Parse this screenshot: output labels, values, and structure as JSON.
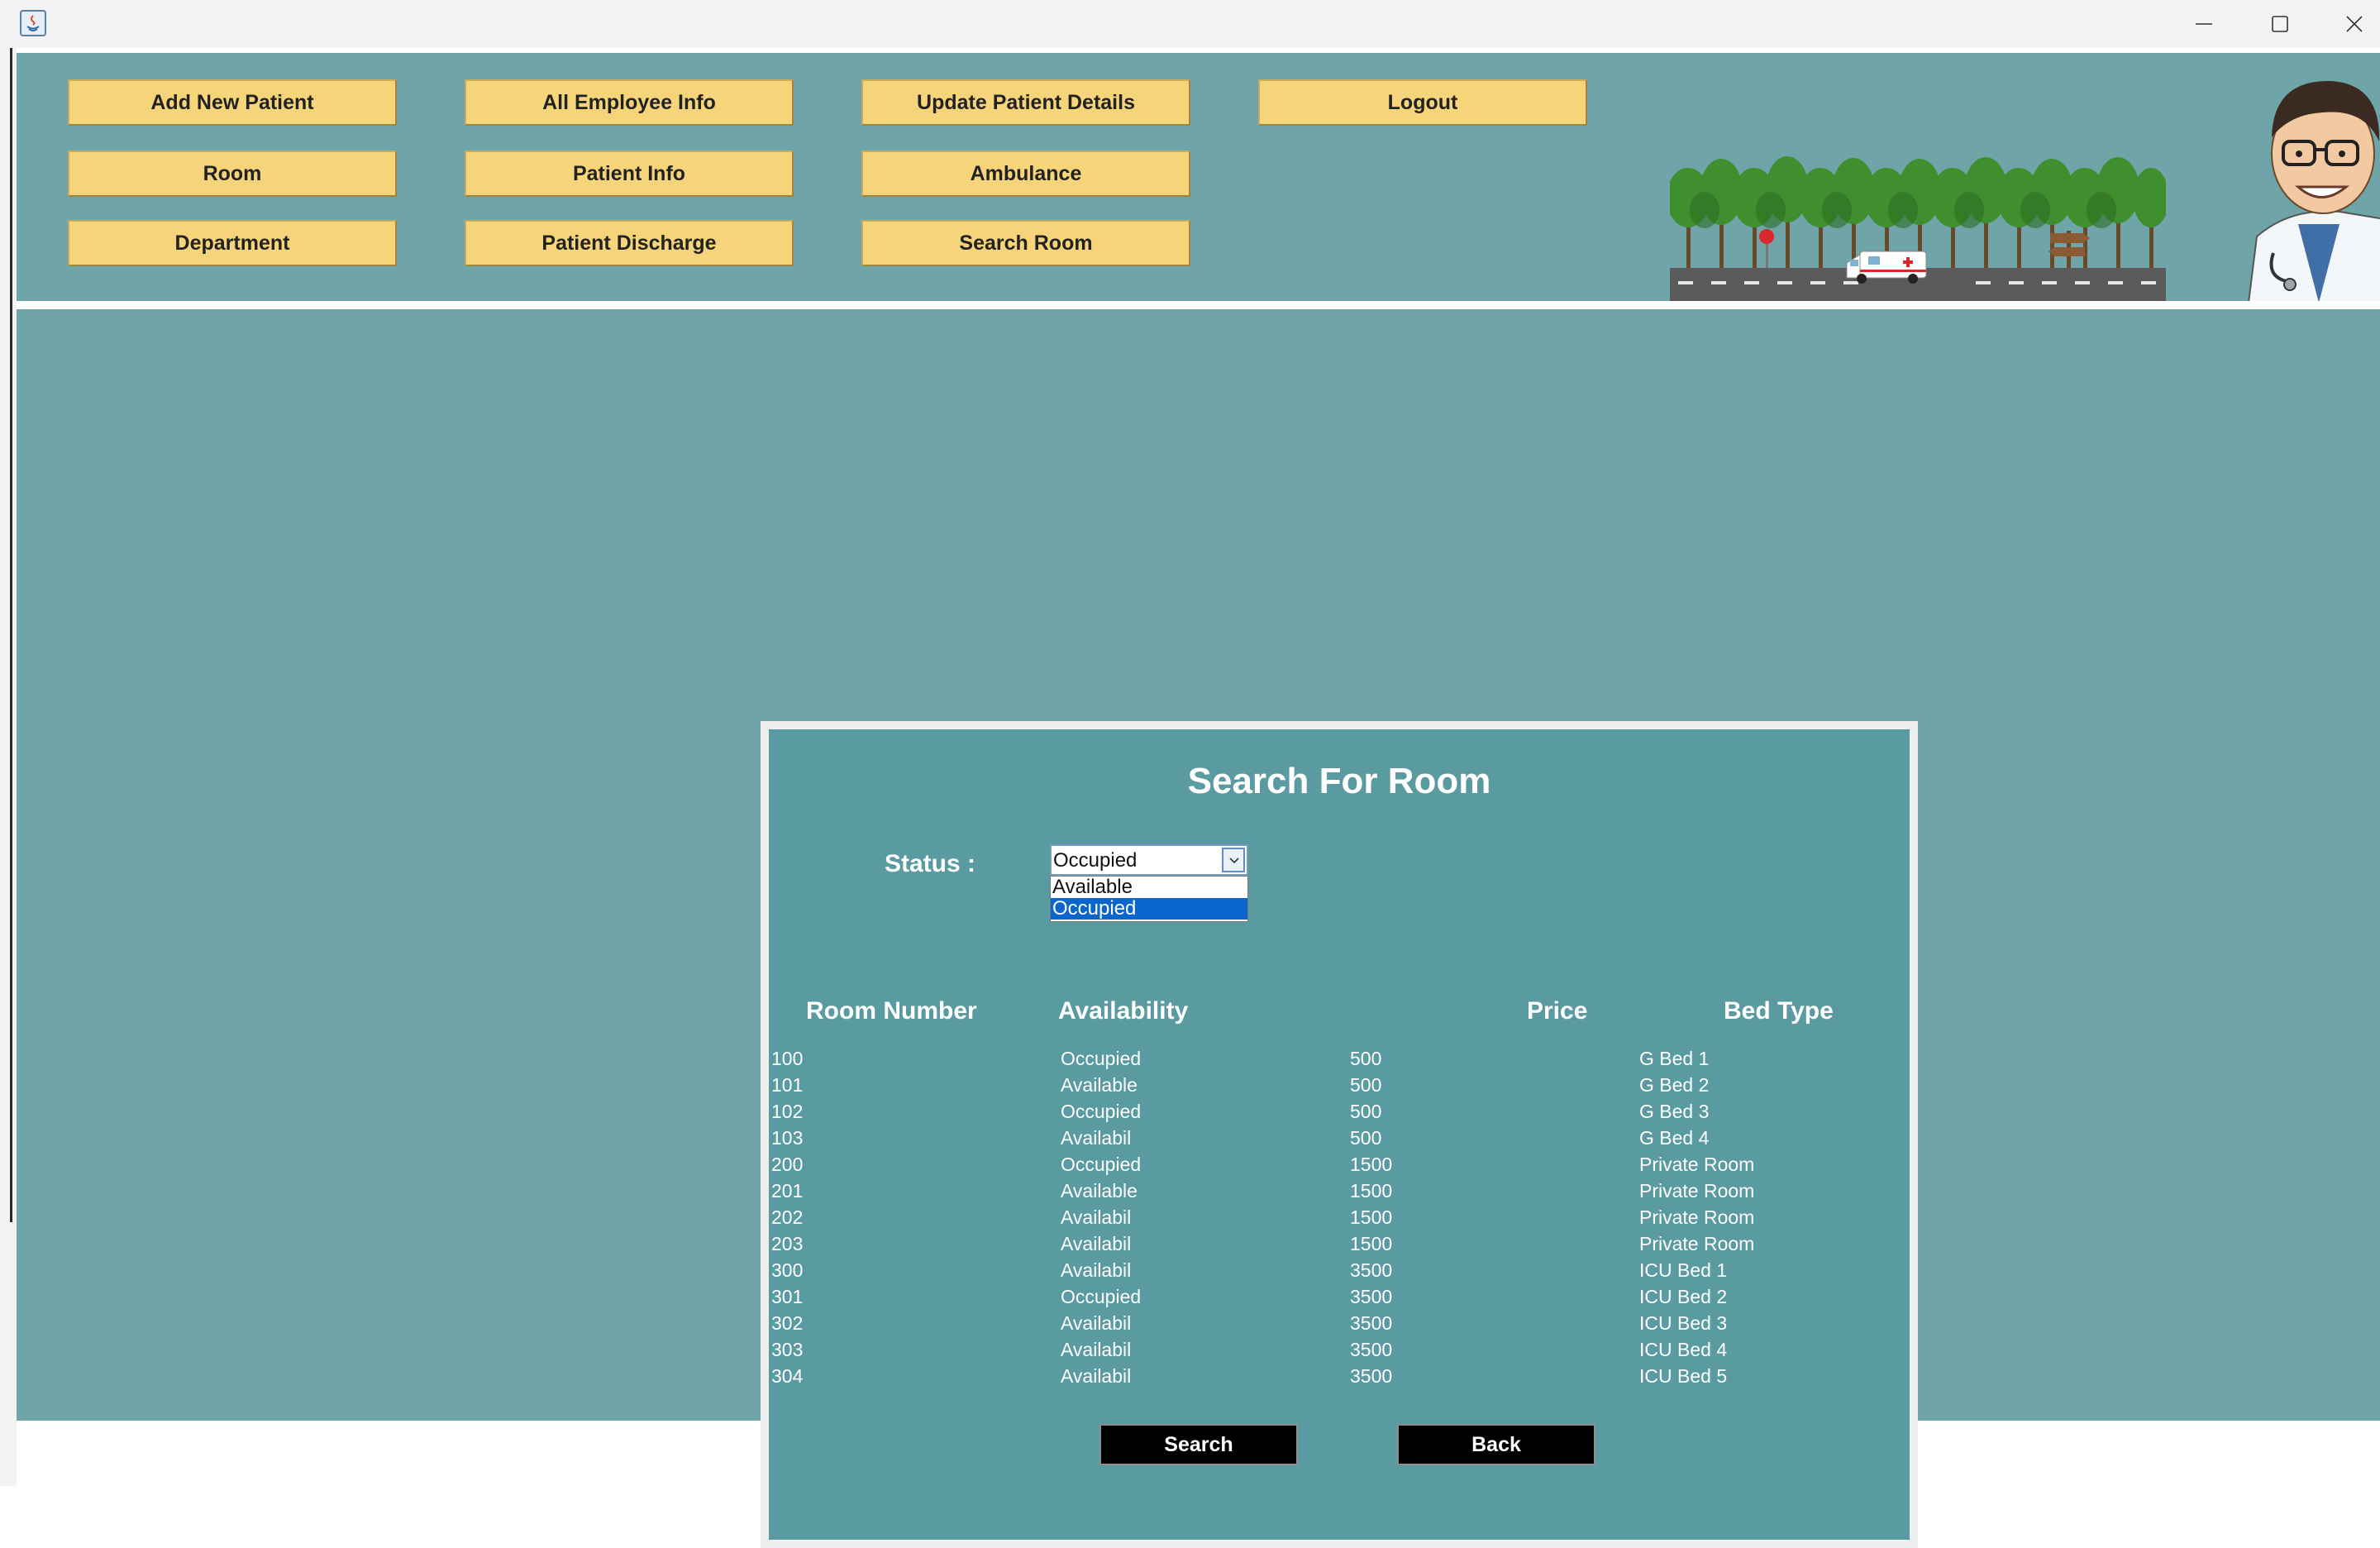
{
  "window": {
    "app_icon": "java-icon",
    "controls": [
      "minimize-icon",
      "maximize-icon",
      "close-icon"
    ]
  },
  "nav": {
    "buttons": [
      {
        "label": "Add New Patient"
      },
      {
        "label": "All Employee Info"
      },
      {
        "label": "Update Patient Details"
      },
      {
        "label": "Logout"
      },
      {
        "label": "Room"
      },
      {
        "label": "Patient Info"
      },
      {
        "label": "Ambulance"
      },
      {
        "label": "Department"
      },
      {
        "label": "Patient Discharge"
      },
      {
        "label": "Search Room"
      }
    ]
  },
  "search_room": {
    "title": "Search For Room",
    "status_label": "Status :",
    "status_selected": "Occupied",
    "status_options": [
      "Available",
      "Occupied"
    ],
    "highlighted_option": "Occupied",
    "columns": [
      "Room Number",
      "Availability",
      "Price",
      "Bed Type"
    ],
    "rows": [
      [
        "100",
        "Occupied",
        "500",
        "G Bed 1"
      ],
      [
        "101",
        "Available",
        "500",
        "G Bed 2"
      ],
      [
        "102",
        "Occupied",
        "500",
        "G Bed 3"
      ],
      [
        "103",
        "Availabil",
        "500",
        "G Bed 4"
      ],
      [
        "200",
        "Occupied",
        "1500",
        "Private Room"
      ],
      [
        "201",
        "Available",
        "1500",
        "Private Room"
      ],
      [
        "202",
        "Availabil",
        "1500",
        "Private Room"
      ],
      [
        "203",
        "Availabil",
        "1500",
        "Private Room"
      ],
      [
        "300",
        "Availabil",
        "3500",
        "ICU Bed 1"
      ],
      [
        "301",
        "Occupied",
        "3500",
        "ICU Bed 2"
      ],
      [
        "302",
        "Availabil",
        "3500",
        "ICU Bed 3"
      ],
      [
        "303",
        "Availabil",
        "3500",
        "ICU Bed 4"
      ],
      [
        "304",
        "Availabil",
        "3500",
        "ICU Bed 5"
      ]
    ],
    "search_label": "Search",
    "back_label": "Back"
  },
  "colors": {
    "background": "#6fa5a8",
    "dialog": "#5a9aa1",
    "nav_button": "#f6d57a",
    "action_button": "#000000",
    "selection": "#0a66cc"
  }
}
